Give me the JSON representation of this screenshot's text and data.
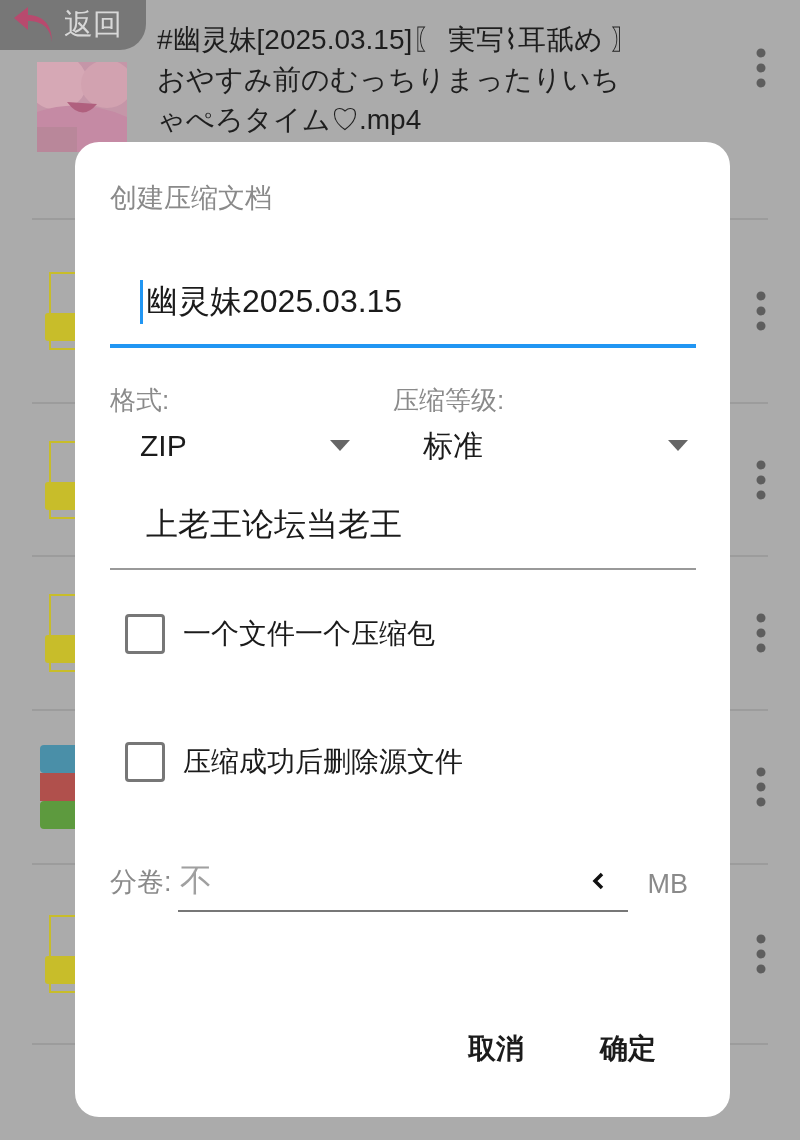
{
  "back_button": {
    "label": "返回"
  },
  "file_list": [
    {
      "kind": "video",
      "name": "#幽灵妹[2025.03.15]〖 実写⌇耳舐め 〗おやすみ前のむっちりまったりいちゃぺろタイム♡.mp4"
    },
    {
      "kind": "text"
    },
    {
      "kind": "text"
    },
    {
      "kind": "text"
    },
    {
      "kind": "archive"
    },
    {
      "kind": "text"
    }
  ],
  "dialog": {
    "title": "创建压缩文档",
    "name_field": {
      "value": "幽灵妹2025.03.15",
      "focused": true
    },
    "format": {
      "label": "格式:",
      "value": "ZIP"
    },
    "level": {
      "label": "压缩等级:",
      "value": "标准"
    },
    "password_field": {
      "value": "上老王论坛当老王",
      "focused": false
    },
    "options": [
      {
        "label": "一个文件一个压缩包",
        "checked": false
      },
      {
        "label": "压缩成功后删除源文件",
        "checked": false
      }
    ],
    "split": {
      "label": "分卷:",
      "placeholder": "不",
      "unit": "MB"
    },
    "buttons": [
      "取消",
      "确定"
    ]
  }
}
